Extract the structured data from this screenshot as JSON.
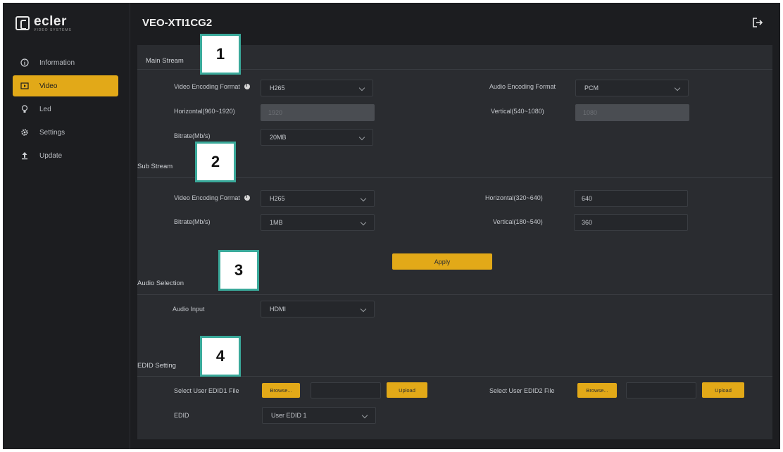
{
  "app": {
    "brand": "ecler",
    "brand_sub": "VIDEO SYSTEMS",
    "device_name": "VEO-XTI1CG2"
  },
  "sidebar": {
    "items": [
      {
        "label": "Information",
        "icon": "info-icon",
        "active": false
      },
      {
        "label": "Video",
        "icon": "video-icon",
        "active": true
      },
      {
        "label": "Led",
        "icon": "led-icon",
        "active": false
      },
      {
        "label": "Settings",
        "icon": "gear-icon",
        "active": false
      },
      {
        "label": "Update",
        "icon": "upload-icon",
        "active": false
      }
    ]
  },
  "main_stream": {
    "title": "Main Stream",
    "video_format_label": "Video Encoding Format",
    "video_format_value": "H265",
    "audio_format_label": "Audio Encoding Format",
    "audio_format_value": "PCM",
    "horizontal_label": "Horizontal(960~1920)",
    "horizontal_value": "1920",
    "vertical_label": "Vertical(540~1080)",
    "vertical_value": "1080",
    "bitrate_label": "Bitrate(Mb/s)",
    "bitrate_value": "20MB"
  },
  "sub_stream": {
    "title": "Sub Stream",
    "video_format_label": "Video Encoding Format",
    "video_format_value": "H265",
    "horizontal_label": "Horizontal(320~640)",
    "horizontal_value": "640",
    "bitrate_label": "Bitrate(Mb/s)",
    "bitrate_value": "1MB",
    "vertical_label": "Vertical(180~540)",
    "vertical_value": "360"
  },
  "apply_label": "Apply",
  "audio_selection": {
    "title": "Audio Selection",
    "input_label": "Audio Input",
    "input_value": "HDMI"
  },
  "edid": {
    "title": "EDID Setting",
    "file1_label": "Select User EDID1 File",
    "file2_label": "Select User EDID2 File",
    "browse_label": "Browse...",
    "upload_label": "Upload",
    "edid_label": "EDID",
    "edid_value": "User EDID 1"
  },
  "callouts": [
    "1",
    "2",
    "3",
    "4"
  ],
  "colors": {
    "accent": "#e2a918",
    "background": "#1c1d20",
    "panel": "#2a2c30",
    "callout_border": "#3aa99a"
  }
}
